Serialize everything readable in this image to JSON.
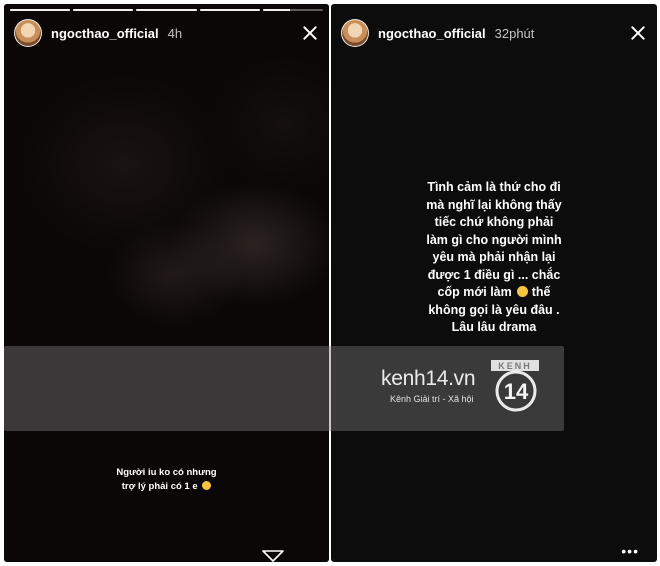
{
  "left_story": {
    "username": "ngocthao_official",
    "time": "4h",
    "progress_segments": [
      1,
      1,
      1,
      1,
      0.45
    ],
    "caption_lines": [
      "Người iu ko có nhưng",
      "trợ lý phải có 1 e"
    ],
    "caption_emoji": "smiling-face-emoji"
  },
  "right_story": {
    "username": "ngocthao_official",
    "time": "32phút",
    "text_lines": [
      "Tình cảm là thứ cho đi",
      "mà nghĩ lại không thấy",
      "tiếc chứ không phải",
      "làm gì cho người mình",
      "yêu mà phải nhận lại",
      "được 1 điều gì ... chắc",
      "cốp mới làm",
      "thế",
      "không gọi là yêu đâu .",
      "Lâu lâu drama"
    ],
    "more_icon": "more-dots-icon"
  },
  "watermark": {
    "site": "kenh14.vn",
    "tagline": "Kênh Giải trí - Xã hội",
    "badge_top": "KENH",
    "badge_number": "14"
  },
  "colors": {
    "left_bg": "#0a0707",
    "right_bg": "#0c0c0c",
    "text": "#ffffff",
    "emoji": "#f6c542"
  }
}
